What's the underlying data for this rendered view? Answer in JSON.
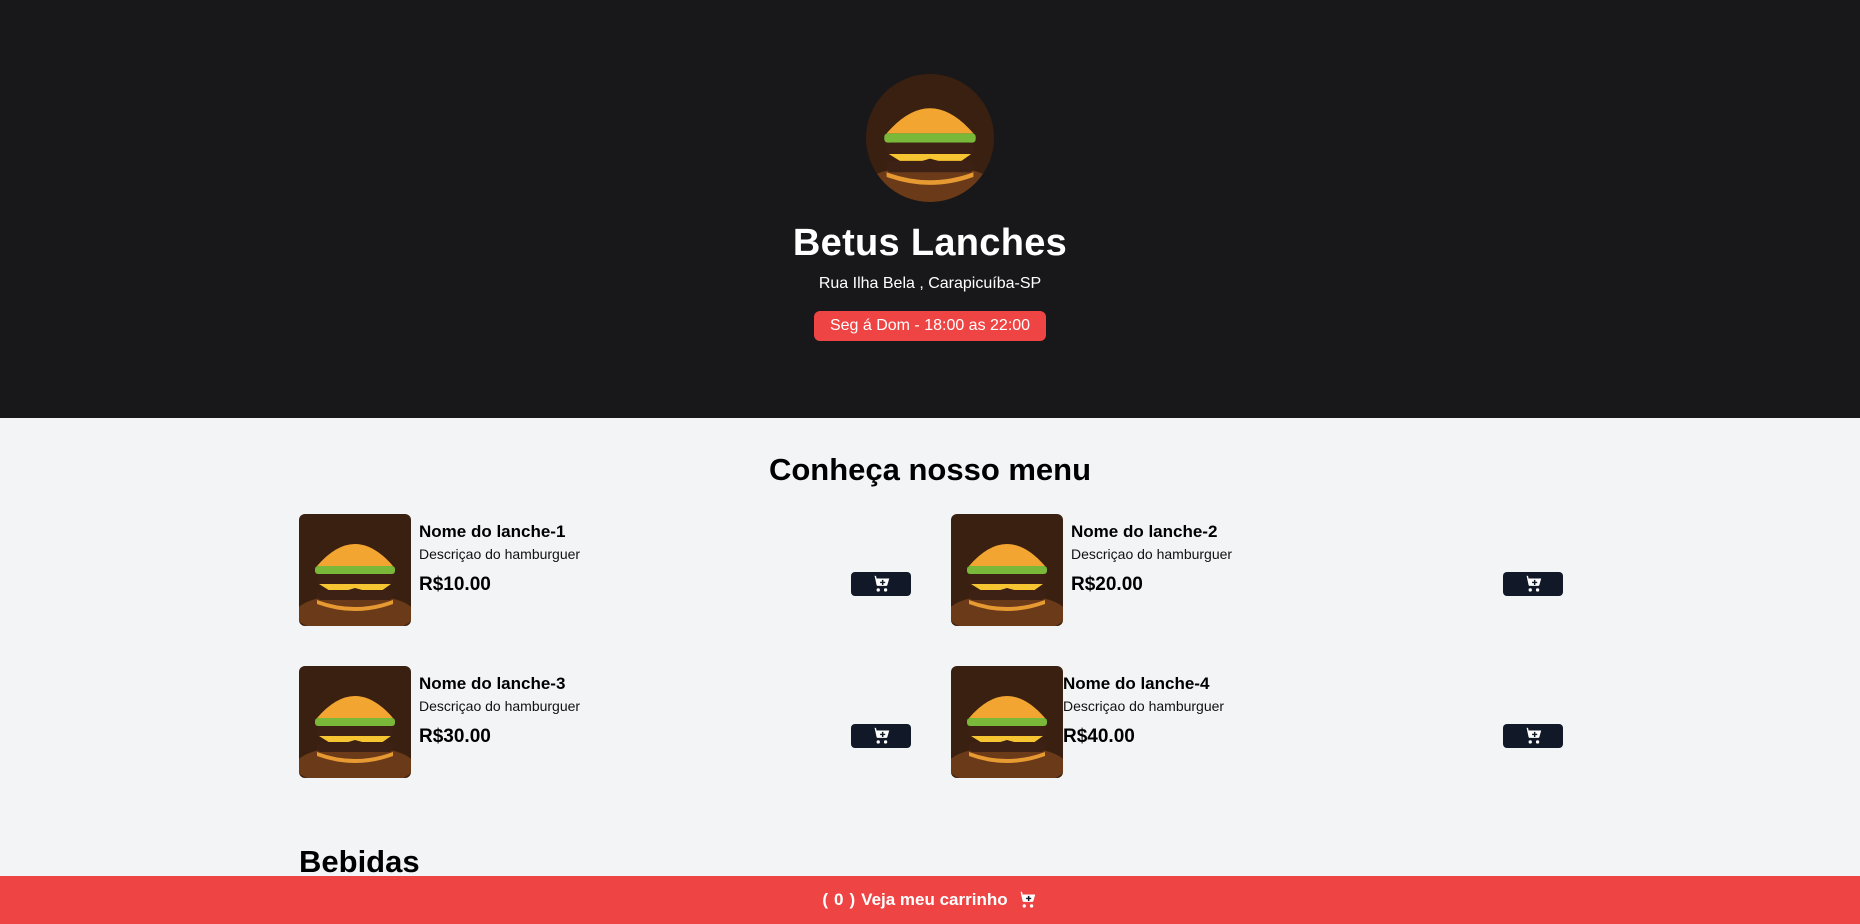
{
  "header": {
    "title": "Betus Lanches",
    "address": "Rua Ilha Bela , Carapicuíba-SP",
    "hours": "Seg á Dom - 18:00 as 22:00"
  },
  "menu": {
    "title": "Conheça nosso menu",
    "items": [
      {
        "name": "Nome do lanche-1",
        "description": "Descriçao do hamburguer",
        "price": "R$10.00"
      },
      {
        "name": "Nome do lanche-2",
        "description": "Descriçao do hamburguer",
        "price": "R$20.00"
      },
      {
        "name": "Nome do lanche-3",
        "description": "Descriçao do hamburguer",
        "price": "R$30.00"
      },
      {
        "name": "Nome do lanche-4",
        "description": "Descriçao do hamburguer",
        "price": "R$40.00"
      }
    ]
  },
  "drinks": {
    "title": "Bebidas"
  },
  "footer": {
    "open_paren": "(",
    "count": "0",
    "close_paren": ")",
    "label": "Veja meu carrinho"
  },
  "colors": {
    "hero_bg": "#18181b",
    "accent": "#ef4444",
    "button_dark": "#111827",
    "page_bg": "#f3f4f6"
  }
}
